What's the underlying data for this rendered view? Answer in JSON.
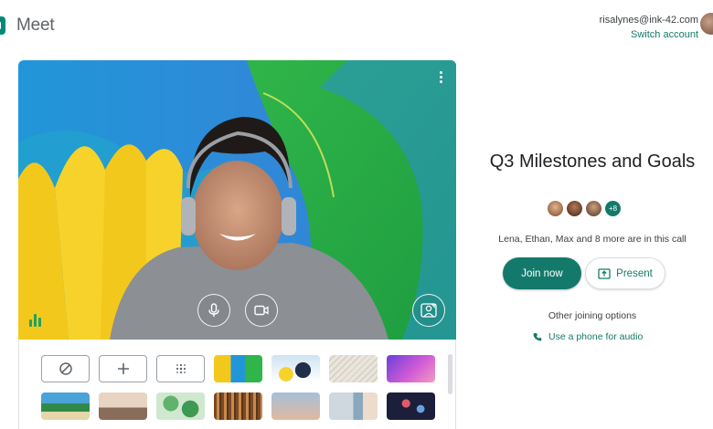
{
  "app": {
    "name": "Meet"
  },
  "account": {
    "email": "risalynes@ink-42.com",
    "switch_label": "Switch account"
  },
  "preview": {
    "controls": {
      "more_icon": "more-vert-icon",
      "mic_icon": "mic-icon",
      "camera_icon": "camera-icon",
      "effects_icon": "background-effects-icon"
    }
  },
  "effects": {
    "row1": [
      "none",
      "blur",
      "slight-blur",
      "bg-paint",
      "bg-circles",
      "bg-sketch",
      "bg-purple"
    ],
    "row2": [
      "bg-beach",
      "bg-city",
      "bg-leaves",
      "bg-library",
      "bg-sunset",
      "bg-street",
      "bg-fireworks"
    ]
  },
  "meeting": {
    "title": "Q3 Milestones and Goals",
    "participant_more": "+8",
    "in_call_text": "Lena, Ethan, Max and 8 more are in this call",
    "join_label": "Join now",
    "present_label": "Present",
    "other_options_label": "Other joining options",
    "phone_label": "Use a phone for audio"
  },
  "colors": {
    "accent": "#137a6b",
    "link": "#1a73e8"
  }
}
